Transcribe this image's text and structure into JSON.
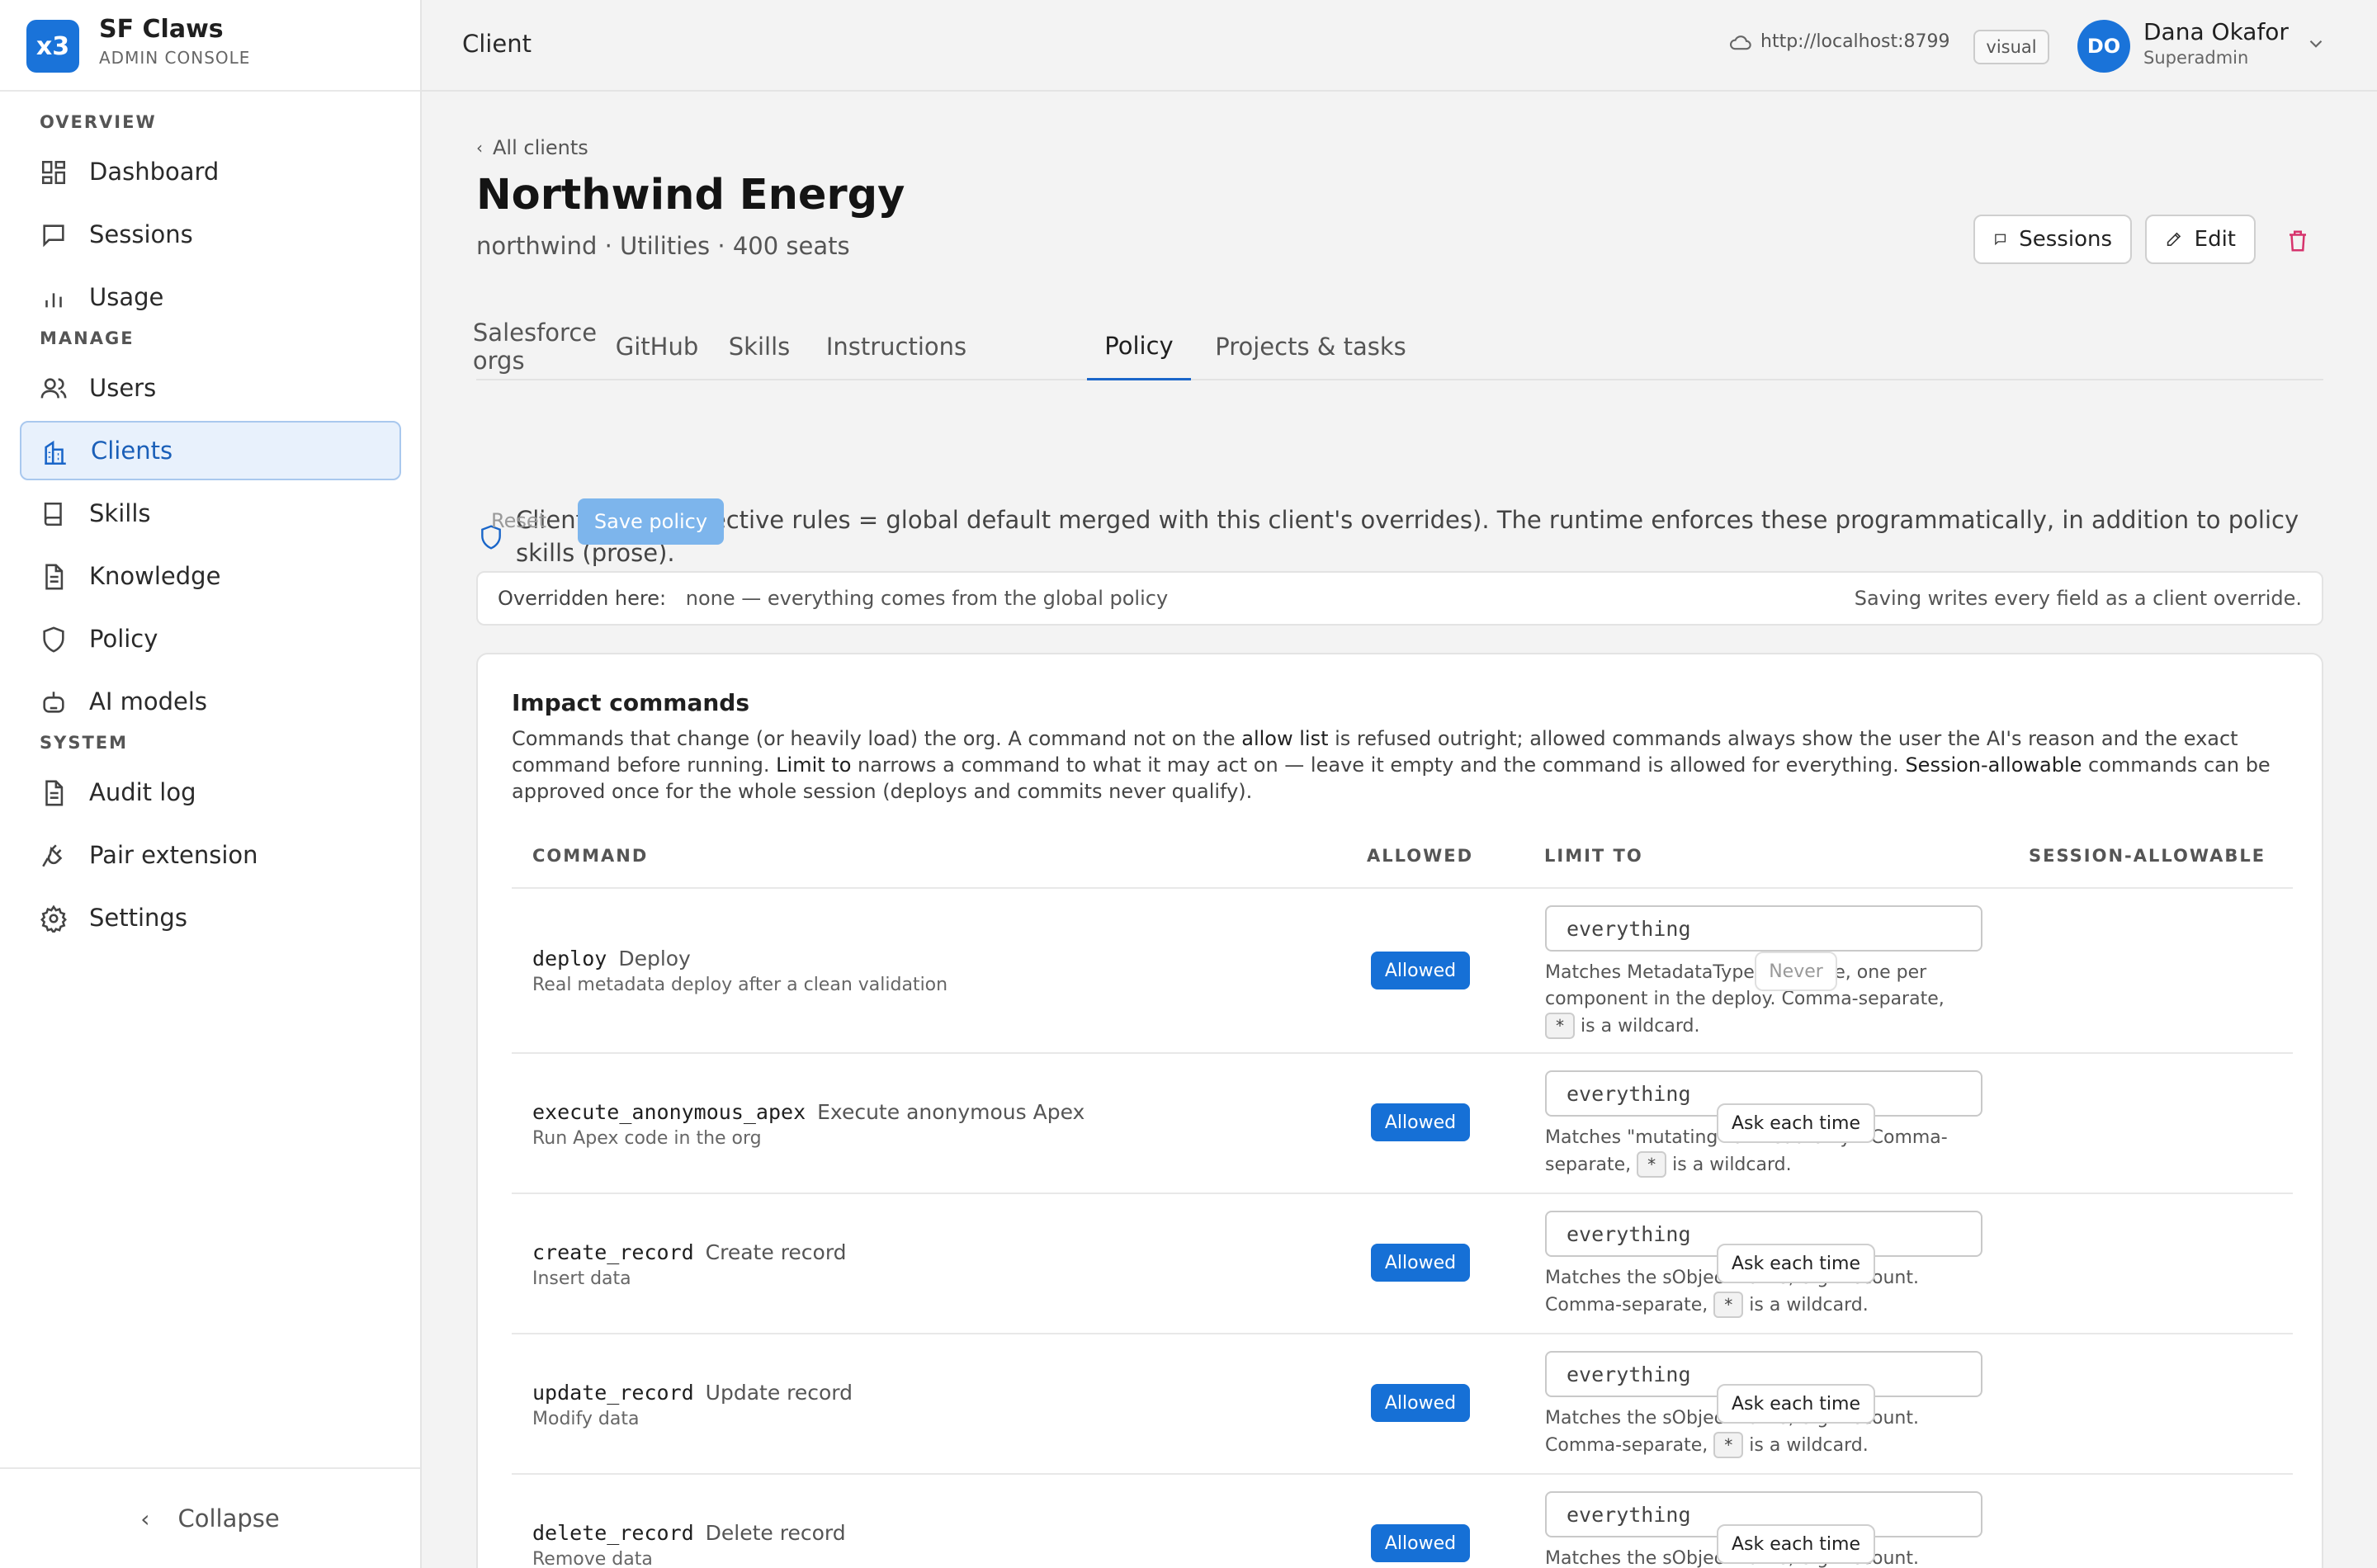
{
  "brand": {
    "logo": "x3",
    "name": "SF Claws",
    "sub": "ADMIN CONSOLE"
  },
  "sidebar": {
    "sections": [
      "OVERVIEW",
      "MANAGE",
      "SYSTEM"
    ],
    "items": [
      {
        "label": "Dashboard",
        "icon": "dashboard-icon"
      },
      {
        "label": "Sessions",
        "icon": "chat-icon"
      },
      {
        "label": "Usage",
        "icon": "bar-chart-icon"
      },
      {
        "label": "Users",
        "icon": "users-icon"
      },
      {
        "label": "Clients",
        "icon": "building-icon",
        "active": true
      },
      {
        "label": "Skills",
        "icon": "book-icon"
      },
      {
        "label": "Knowledge",
        "icon": "document-icon"
      },
      {
        "label": "Policy",
        "icon": "shield-icon"
      },
      {
        "label": "AI models",
        "icon": "robot-icon"
      },
      {
        "label": "Audit log",
        "icon": "document-icon"
      },
      {
        "label": "Pair extension",
        "icon": "plug-icon"
      },
      {
        "label": "Settings",
        "icon": "gear-icon"
      }
    ],
    "collapse": "Collapse"
  },
  "topbar": {
    "title": "Client",
    "url": "http://localhost:8799",
    "mode_badge": "visual",
    "user": {
      "initials": "DO",
      "name": "Dana Okafor",
      "role": "Superadmin"
    }
  },
  "client": {
    "back": "All clients",
    "name": "Northwind Energy",
    "meta": "northwind · Utilities · 400 seats",
    "actions": {
      "sessions": "Sessions",
      "edit": "Edit"
    }
  },
  "tabs": [
    "Salesforce orgs",
    "GitHub",
    "Skills",
    "Instructions",
    "Policy",
    "Projects & tasks"
  ],
  "active_tab": "Policy",
  "policy": {
    "info": "Client policy (effective rules = global default merged with this client's overrides). The runtime enforces these programmatically, in addition to policy skills (prose).",
    "reset": "Reset",
    "save": "Save policy",
    "overridden_label": "Overridden here:",
    "overridden_value": "none — everything comes from the global policy",
    "save_note": "Saving writes every field as a client override."
  },
  "impact": {
    "title": "Impact commands",
    "desc_1": "Commands that change (or heavily load) the org. A command not on the ",
    "desc_allow": "allow list",
    "desc_2": " is refused outright; allowed commands always show the user the AI's reason and the exact command before running. ",
    "desc_limit": "Limit to",
    "desc_3": " narrows a command to what it may act on — leave it empty and the command is allowed for everything. ",
    "desc_session": "Session-allowable",
    "desc_4": " commands can be approved once for the whole session (deploys and commits never qualify).",
    "headers": {
      "command": "COMMAND",
      "allowed": "ALLOWED",
      "limit": "LIMIT TO",
      "session": "SESSION-ALLOWABLE"
    },
    "rows": [
      {
        "code": "deploy",
        "name": "Deploy",
        "sub": "Real metadata deploy after a clean validation",
        "allowed": "Allowed",
        "limit": "everything",
        "hint_a": "Matches MetadataType:FullName, one per component in the deploy. Comma-separate,",
        "wild": "*",
        "hint_b": "is a wildcard.",
        "session": "Never"
      },
      {
        "code": "execute_anonymous_apex",
        "name": "Execute anonymous Apex",
        "sub": "Run Apex code in the org",
        "allowed": "Allowed",
        "limit": "everything",
        "hint_a": "Matches \"mutating\" or \"read-only\". Comma-separate,",
        "wild": "*",
        "hint_b": "is a wildcard.",
        "session": "Ask each time"
      },
      {
        "code": "create_record",
        "name": "Create record",
        "sub": "Insert data",
        "allowed": "Allowed",
        "limit": "everything",
        "hint_a": "Matches the sObject name, e.g. Account. Comma-separate,",
        "wild": "*",
        "hint_b": "is a wildcard.",
        "session": "Ask each time"
      },
      {
        "code": "update_record",
        "name": "Update record",
        "sub": "Modify data",
        "allowed": "Allowed",
        "limit": "everything",
        "hint_a": "Matches the sObject name, e.g. Account. Comma-separate,",
        "wild": "*",
        "hint_b": "is a wildcard.",
        "session": "Ask each time"
      },
      {
        "code": "delete_record",
        "name": "Delete record",
        "sub": "Remove data",
        "allowed": "Allowed",
        "limit": "everything",
        "hint_a": "Matches the sObject name, e.g. Account.",
        "session": "Ask each time"
      }
    ]
  },
  "colors": {
    "accent": "#1a73d9",
    "active_bg": "#e8f1fc",
    "danger": "#d6336c"
  }
}
